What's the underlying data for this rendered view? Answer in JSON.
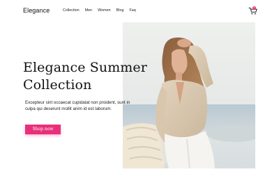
{
  "brand": "Elegance",
  "nav": {
    "items": [
      {
        "label": "Collection"
      },
      {
        "label": "Men"
      },
      {
        "label": "Women"
      },
      {
        "label": "Blog"
      },
      {
        "label": "Faq"
      }
    ],
    "cart_icon": "cart-icon",
    "cart_count": "0"
  },
  "hero": {
    "title_line1": "Elegance Summer",
    "title_line2": "Collection",
    "description_line1": "Excepteur sint occaecat cupidatat non proident, sunt in",
    "description_line2": "culpa qui deserunt mollit anim id est laborum.",
    "cta_label": "Shop now",
    "accent_color": "#e8307a"
  }
}
